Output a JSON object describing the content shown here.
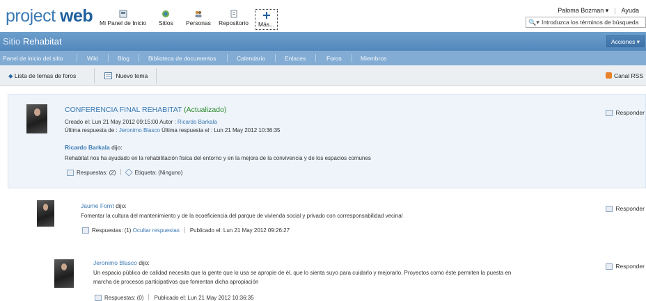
{
  "header": {
    "logo_part1": "pr",
    "logo_o": "o",
    "logo_part2": "ject ",
    "logo_bold": "web",
    "nav": [
      {
        "label": "Mi Panel de Inicio",
        "icon": "dashboard-icon"
      },
      {
        "label": "Sitios",
        "icon": "sites-icon"
      },
      {
        "label": "Personas",
        "icon": "people-icon"
      },
      {
        "label": "Repositorio",
        "icon": "repository-icon"
      },
      {
        "label": "Más...",
        "icon": "plus-icon"
      }
    ],
    "user_name": "Paloma Bozman ▾",
    "help": "Ayuda",
    "search_placeholder": "Introduzca los términos de búsqueda"
  },
  "sitebar": {
    "prefix": "Sitio ",
    "title": "Rehabitat",
    "actions_label": "Acciones ▾"
  },
  "tabs": [
    "Panel de inicio del sitio",
    "Wiki",
    "Blog",
    "Biblioteca de documentos",
    "Calendario",
    "Enlaces",
    "Foros",
    "Miembros"
  ],
  "active_tab": "Foros",
  "toolbar": {
    "back_label": "Lista de temas de foros",
    "new_topic_label": "Nuevo tema",
    "rss_label": "Canal RSS"
  },
  "topic": {
    "title": "CONFERENCIA FINAL REHABITAT",
    "updated": "(Actualizado)",
    "created_prefix": "Creado el: Lun 21 May 2012 09:15:00 Autor : ",
    "created_author": "Ricardo Barkala",
    "last_reply_prefix": "Última respuesta de : ",
    "last_reply_author": "Jeronimo Blasco",
    "last_reply_suffix": " Última respuesta el : Lun 21 May 2012 10:36:35",
    "speaker": "Ricardo Barkala",
    "said": " dijo:",
    "body": "Rehabitat nos ha ayudado en la rehabilitación física del entorno y en la mejora de la convivencia y de los espacios comunes",
    "replies": "Respuestas: (2)",
    "tag": "Etiqueta: (Ninguno)",
    "respond": "Responder"
  },
  "reply1": {
    "author": "Jaume Fornt",
    "said": " dijo:",
    "body": "Fomentar la cultura del mantenimiento y de la ecoeficiencia del parque de vivienda social y privado con corresponsabilidad vecinal",
    "replies": "Respuestas: (1) ",
    "hide": "Ocultar respuestas",
    "published": "Publicado el: Lun 21 May 2012 09:26:27",
    "respond": "Responder"
  },
  "reply2": {
    "author": "Jeronimo Blasco",
    "said": " dijo:",
    "body_line1": "Un espacio público de calidad necesita que la gente que lo usa se apropie de él, que lo sienta suyo para cuidarlo y mejorarlo. Proyectos como éste permiten la puesta en",
    "body_line2": "marcha de procesos participativos que fomentan dicha apropiación",
    "replies": "Respuestas: (0)",
    "published": "Publicado el: Lun 21 May 2012 10:36:35",
    "respond": "Responder"
  }
}
